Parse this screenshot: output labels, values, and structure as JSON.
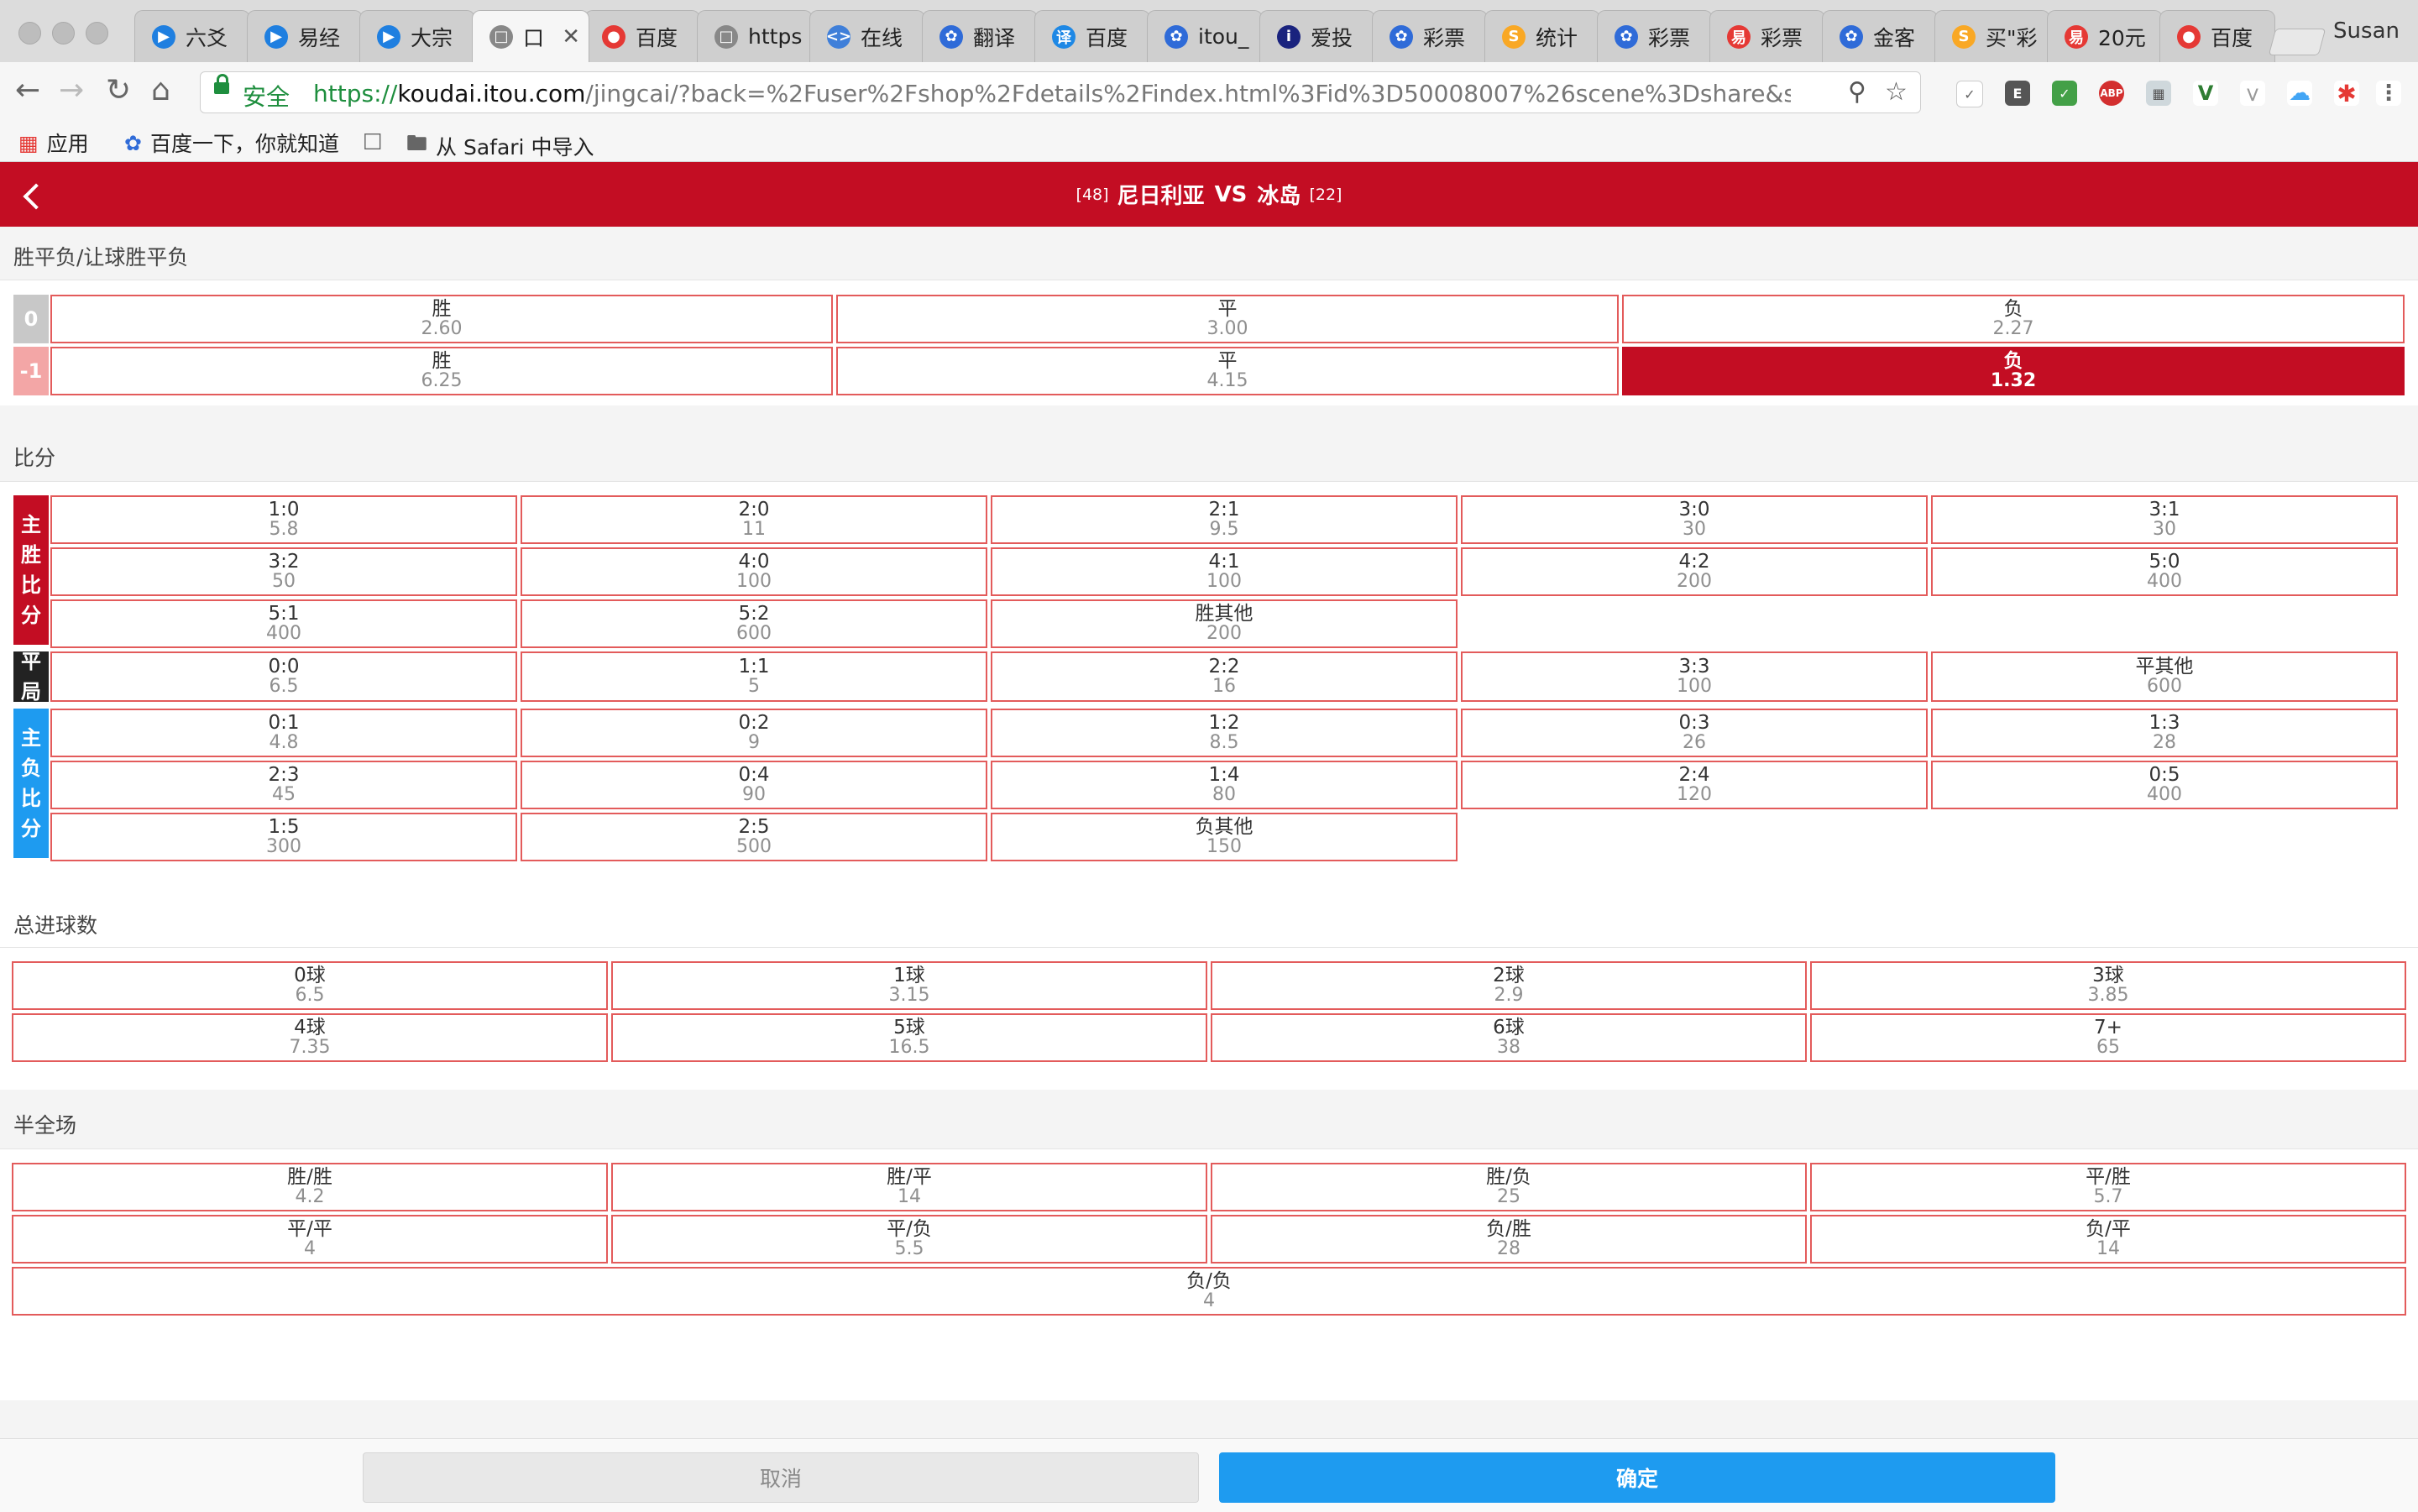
{
  "browser": {
    "tabs": [
      {
        "label": "六爻",
        "icon": "app-circle-icon",
        "color": "#1f7fe0"
      },
      {
        "label": "易经",
        "icon": "app-circle-icon",
        "color": "#1f7fe0"
      },
      {
        "label": "大宗",
        "icon": "app-circle-icon",
        "color": "#1f7fe0"
      },
      {
        "label": "口",
        "icon": "blank-page-icon",
        "color": "#888888"
      },
      {
        "label": "百度",
        "icon": "map-pin-icon",
        "color": "#e53935"
      },
      {
        "label": "https",
        "icon": "blank-page-icon",
        "color": "#888888"
      },
      {
        "label": "在线",
        "icon": "code-icon",
        "color": "#3f7fd9"
      },
      {
        "label": "翻译",
        "icon": "baidu-paw-icon",
        "color": "#2f6bd8"
      },
      {
        "label": "百度",
        "icon": "translate-icon",
        "color": "#1e88e5"
      },
      {
        "label": "itou_",
        "icon": "baidu-paw-icon",
        "color": "#2f6bd8"
      },
      {
        "label": "爱投",
        "icon": "info-icon",
        "color": "#1a237e"
      },
      {
        "label": "彩票",
        "icon": "baidu-paw-icon",
        "color": "#2f6bd8"
      },
      {
        "label": "统计",
        "icon": "s-logo-icon",
        "color": "#f9a825"
      },
      {
        "label": "彩票",
        "icon": "baidu-paw-icon",
        "color": "#2f6bd8"
      },
      {
        "label": "彩票",
        "icon": "lottery-logo-icon",
        "color": "#e53935"
      },
      {
        "label": "金客",
        "icon": "baidu-paw-icon",
        "color": "#2f6bd8"
      },
      {
        "label": "买\"彩",
        "icon": "s-logo-icon",
        "color": "#f9a825"
      },
      {
        "label": "20元",
        "icon": "lottery-logo-icon",
        "color": "#e53935"
      },
      {
        "label": "百度",
        "icon": "map-pin-icon",
        "color": "#e53935"
      }
    ],
    "profile_name": "Susan",
    "secure_label": "安全",
    "url_prefix": "https://",
    "url_host": "koudai.itou.com",
    "url_path": "/jingcai/?back=%2Fuser%2Fshop%2Fdetails%2Findex.html%3Fid%3D50008007%26scene%3Dshare&scene=station...",
    "bookmarks": [
      {
        "label": "应用",
        "icon": "apps-grid-icon"
      },
      {
        "label": "百度一下，你就知道",
        "icon": "baidu-paw-icon"
      },
      {
        "label": "",
        "icon": "blank-page-icon"
      },
      {
        "label": "从 Safari 中导入",
        "icon": "folder-icon"
      }
    ]
  },
  "match": {
    "home_rank": "[48]",
    "home_team": "尼日利亚",
    "vs": "VS",
    "away_team": "冰岛",
    "away_rank": "[22]"
  },
  "colors": {
    "brand_red": "#c30d23",
    "confirm_blue": "#1e9bf0",
    "draw_black": "#222222"
  },
  "sections": {
    "spf_title": "胜平负/让球胜平负",
    "score_title": "比分",
    "goals_title": "总进球数",
    "halffull_title": "半全场"
  },
  "spf": {
    "rows": [
      {
        "handicap": "0",
        "cells": [
          {
            "name": "胜",
            "odds": "2.60"
          },
          {
            "name": "平",
            "odds": "3.00"
          },
          {
            "name": "负",
            "odds": "2.27"
          }
        ]
      },
      {
        "handicap": "-1",
        "cells": [
          {
            "name": "胜",
            "odds": "6.25"
          },
          {
            "name": "平",
            "odds": "4.15"
          },
          {
            "name": "负",
            "odds": "1.32",
            "selected": true
          }
        ]
      }
    ]
  },
  "score": {
    "home_win_label": "主胜比分",
    "draw_label": "平局",
    "away_win_label": "主负比分",
    "home_win": [
      {
        "name": "1:0",
        "odds": "5.8"
      },
      {
        "name": "2:0",
        "odds": "11"
      },
      {
        "name": "2:1",
        "odds": "9.5"
      },
      {
        "name": "3:0",
        "odds": "30"
      },
      {
        "name": "3:1",
        "odds": "30"
      },
      {
        "name": "3:2",
        "odds": "50"
      },
      {
        "name": "4:0",
        "odds": "100"
      },
      {
        "name": "4:1",
        "odds": "100"
      },
      {
        "name": "4:2",
        "odds": "200"
      },
      {
        "name": "5:0",
        "odds": "400"
      },
      {
        "name": "5:1",
        "odds": "400"
      },
      {
        "name": "5:2",
        "odds": "600"
      },
      {
        "name": "胜其他",
        "odds": "200"
      }
    ],
    "draw": [
      {
        "name": "0:0",
        "odds": "6.5"
      },
      {
        "name": "1:1",
        "odds": "5"
      },
      {
        "name": "2:2",
        "odds": "16"
      },
      {
        "name": "3:3",
        "odds": "100"
      },
      {
        "name": "平其他",
        "odds": "600"
      }
    ],
    "away_win": [
      {
        "name": "0:1",
        "odds": "4.8"
      },
      {
        "name": "0:2",
        "odds": "9"
      },
      {
        "name": "1:2",
        "odds": "8.5"
      },
      {
        "name": "0:3",
        "odds": "26"
      },
      {
        "name": "1:3",
        "odds": "28"
      },
      {
        "name": "2:3",
        "odds": "45"
      },
      {
        "name": "0:4",
        "odds": "90"
      },
      {
        "name": "1:4",
        "odds": "80"
      },
      {
        "name": "2:4",
        "odds": "120"
      },
      {
        "name": "0:5",
        "odds": "400"
      },
      {
        "name": "1:5",
        "odds": "300"
      },
      {
        "name": "2:5",
        "odds": "500"
      },
      {
        "name": "负其他",
        "odds": "150"
      }
    ]
  },
  "goals": [
    {
      "name": "0球",
      "odds": "6.5"
    },
    {
      "name": "1球",
      "odds": "3.15"
    },
    {
      "name": "2球",
      "odds": "2.9"
    },
    {
      "name": "3球",
      "odds": "3.85"
    },
    {
      "name": "4球",
      "odds": "7.35"
    },
    {
      "name": "5球",
      "odds": "16.5"
    },
    {
      "name": "6球",
      "odds": "38"
    },
    {
      "name": "7+",
      "odds": "65"
    }
  ],
  "halffull": [
    {
      "name": "胜/胜",
      "odds": "4.2"
    },
    {
      "name": "胜/平",
      "odds": "14"
    },
    {
      "name": "胜/负",
      "odds": "25"
    },
    {
      "name": "平/胜",
      "odds": "5.7"
    },
    {
      "name": "平/平",
      "odds": "4"
    },
    {
      "name": "平/负",
      "odds": "5.5"
    },
    {
      "name": "负/胜",
      "odds": "28"
    },
    {
      "name": "负/平",
      "odds": "14"
    },
    {
      "name": "负/负",
      "odds": "4"
    }
  ],
  "footer": {
    "cancel_label": "取消",
    "confirm_label": "确定"
  }
}
